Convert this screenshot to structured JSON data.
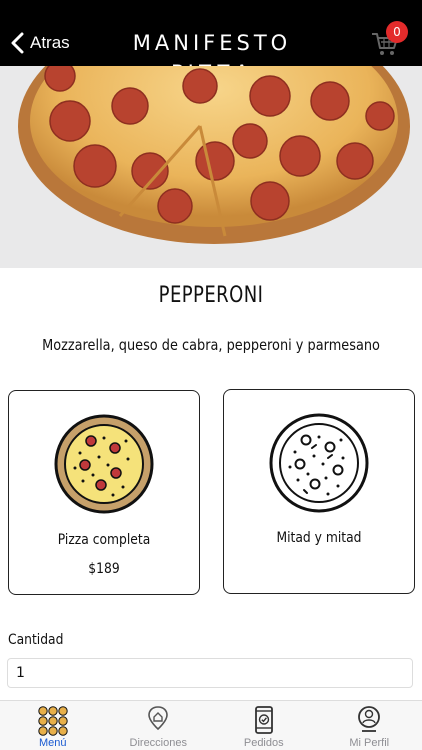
{
  "header": {
    "back_label": "Atras",
    "brand": "MANIFESTO PIZZA",
    "cart_count": "0"
  },
  "colors": {
    "topbar": "#000000",
    "badge": "#e32b2b",
    "active_tab": "#1a5ad1",
    "pizza_crust": "#c6a06a",
    "pizza_cheese": "#f5e27a",
    "pepperoni": "#c0393b"
  },
  "product": {
    "name": "PEPPERONI",
    "description": "Mozzarella, queso de cabra, pepperoni y parmesano"
  },
  "options": [
    {
      "label": "Pizza completa",
      "price": "$189",
      "icon": "full-pizza-icon"
    },
    {
      "label": "Mitad y mitad",
      "icon": "half-half-pizza-icon"
    }
  ],
  "quantity": {
    "label": "Cantidad",
    "value": "1"
  },
  "tabs": [
    {
      "label": "Menú",
      "icon": "grid-menu-icon",
      "active": true
    },
    {
      "label": "Direcciones",
      "icon": "location-icon",
      "active": false
    },
    {
      "label": "Pedidos",
      "icon": "phone-order-icon",
      "active": false
    },
    {
      "label": "Mi Perfil",
      "icon": "profile-icon",
      "active": false
    }
  ]
}
